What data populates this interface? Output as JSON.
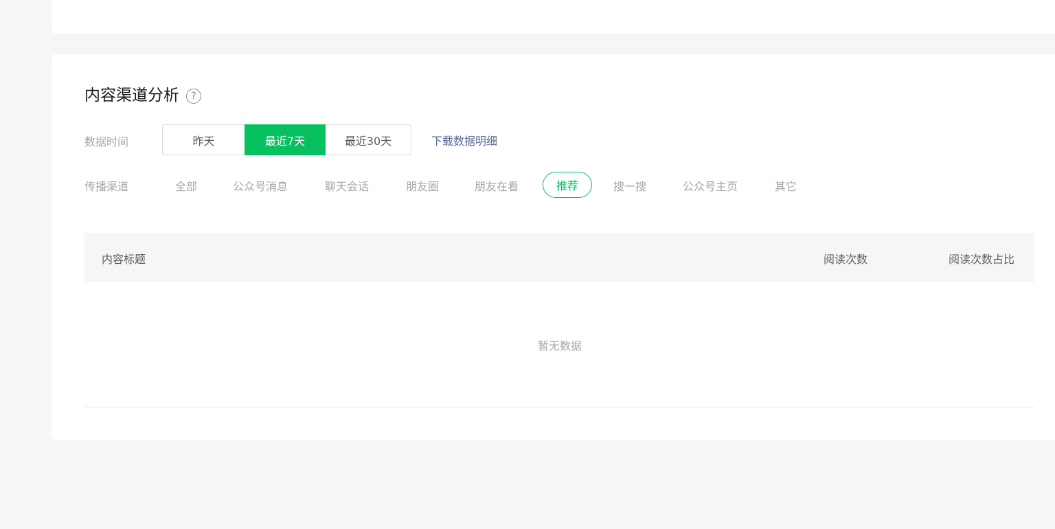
{
  "section": {
    "title": "内容渠道分析",
    "help_icon": "question-circle-icon",
    "help_glyph": "?"
  },
  "time_filter": {
    "label": "数据时间",
    "options": [
      "昨天",
      "最近7天",
      "最近30天"
    ],
    "selected": "最近7天",
    "download_label": "下载数据明细"
  },
  "channel_filter": {
    "label": "传播渠道",
    "options": [
      "全部",
      "公众号消息",
      "聊天会话",
      "朋友圈",
      "朋友在看",
      "推荐",
      "搜一搜",
      "公众号主页",
      "其它"
    ],
    "selected": "推荐"
  },
  "table": {
    "columns": [
      "内容标题",
      "阅读次数",
      "阅读次数占比"
    ],
    "empty_text": "暂无数据"
  },
  "colors": {
    "accent": "#07c160",
    "link": "#576b95",
    "background": "#f5f6f8"
  }
}
